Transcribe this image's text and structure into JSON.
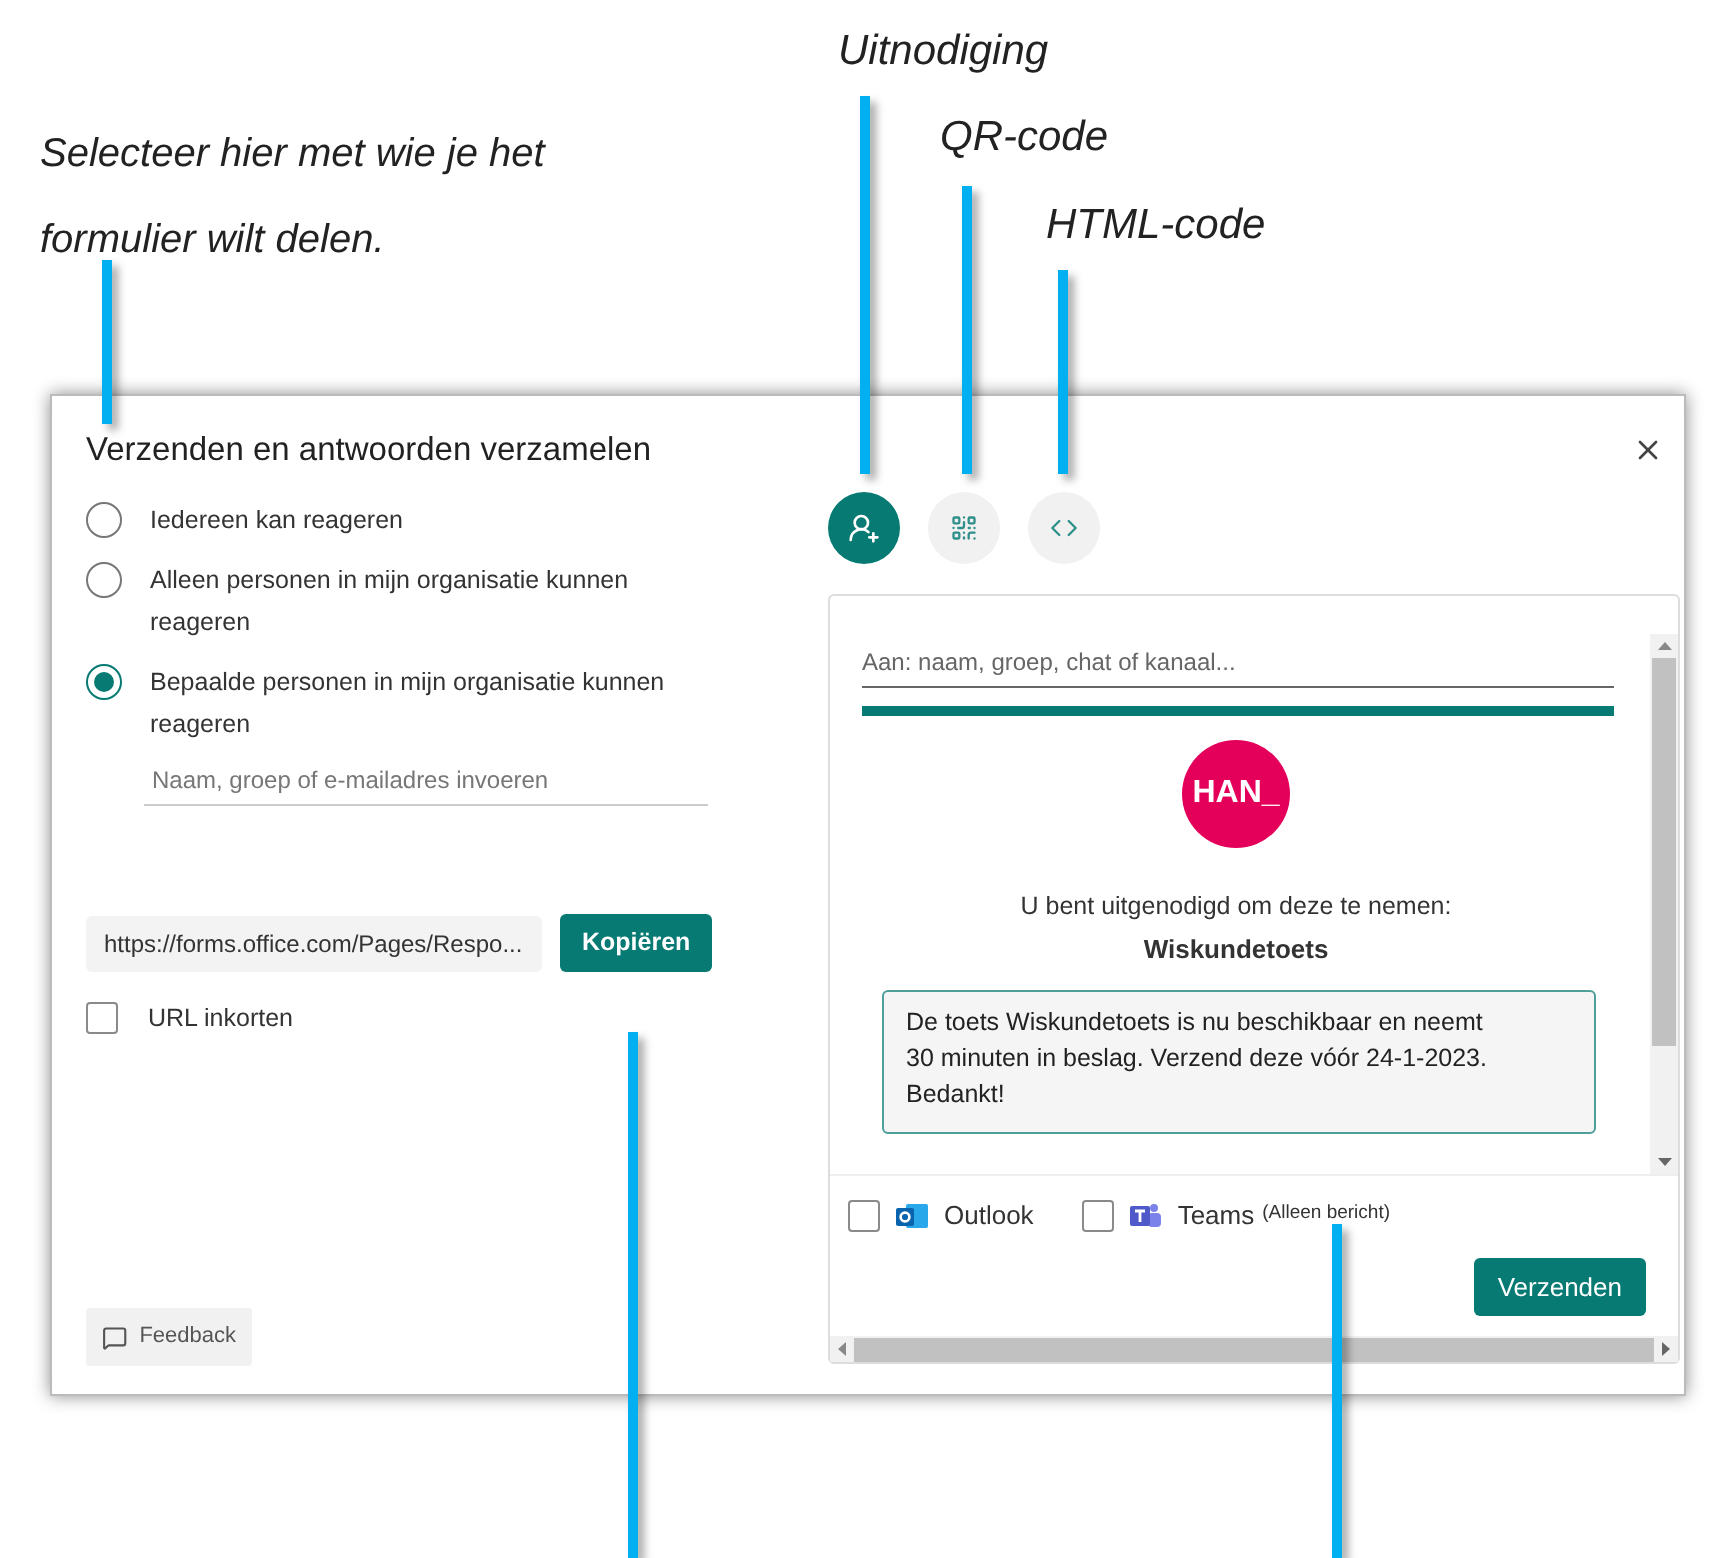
{
  "annotations": [
    {
      "label": "Selecteer hier met wie je het formulier wilt delen."
    },
    {
      "label": "Uitnodiging"
    },
    {
      "label": "QR-code"
    },
    {
      "label": "HTML-code"
    }
  ],
  "dialog": {
    "title": "Verzenden en antwoorden verzamelen",
    "audience": [
      {
        "label": "Iedereen kan reageren",
        "selected": false
      },
      {
        "label": "Alleen personen in mijn organisatie kunnen reageren",
        "selected": false
      },
      {
        "label": "Bepaalde personen in mijn organisatie kunnen reageren",
        "selected": true
      }
    ],
    "people_field": {
      "placeholder": "Naam, groep of e-mailadres invoeren"
    },
    "link": {
      "value": "https://forms.office.com/Pages/Respo...",
      "button": "Kopiëren"
    },
    "shorten_url": {
      "label": "URL inkorten",
      "checked": false
    },
    "feedback": "Feedback",
    "share_tabs": [
      {
        "kind": "invite",
        "selected": true
      },
      {
        "kind": "qr",
        "selected": false
      },
      {
        "kind": "html",
        "selected": false
      }
    ],
    "invite": {
      "to_placeholder": "Aan: naam, groep, chat of kanaal...",
      "logo": "HAN_",
      "intro": "U bent uitgenodigd om deze te nemen:",
      "form_title": "Wiskundetoets",
      "message": "De toets Wiskundetoets is nu beschikbaar en neemt 30 minuten in beslag. Verzend deze vóór 24-1-2023. Bedankt!",
      "channels": [
        {
          "kind": "outlook",
          "label": "Outlook",
          "checked": false
        },
        {
          "kind": "teams",
          "label": "Teams",
          "note": "(Alleen bericht)",
          "checked": false
        }
      ],
      "send": "Verzenden"
    }
  }
}
